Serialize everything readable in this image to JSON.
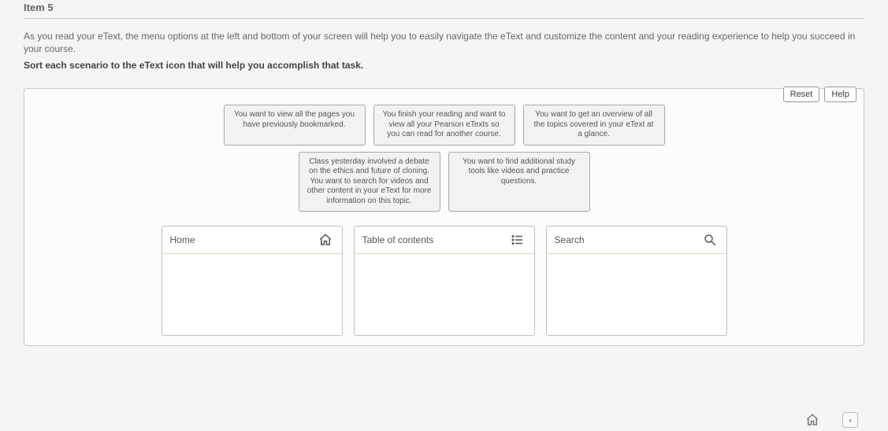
{
  "header": {
    "item_label": "Item 5"
  },
  "intro_text": "As you read your eText, the menu options at the left and bottom of your screen will help you to easily navigate the eText and customize the content and your reading experience to help you succeed in your course.",
  "instruction_text": "Sort each scenario to the eText icon that will help you accomplish that task.",
  "buttons": {
    "reset": "Reset",
    "help": "Help"
  },
  "cards": {
    "row1": [
      "You want to view all the pages you have previously bookmarked.",
      "You finish your reading and want to view all your Pearson eTexts so you can read for another course.",
      "You want to get an overview of all the topics covered in your eText at a glance."
    ],
    "row2": [
      "Class yesterday involved a debate on the ethics and future of cloning. You want to search for videos and other content in your eText for more information on this topic.",
      "You want to find additional study tools like videos and practice questions."
    ]
  },
  "drop_zones": [
    {
      "label": "Home",
      "icon": "home"
    },
    {
      "label": "Table of contents",
      "icon": "toc"
    },
    {
      "label": "Search",
      "icon": "search"
    }
  ]
}
